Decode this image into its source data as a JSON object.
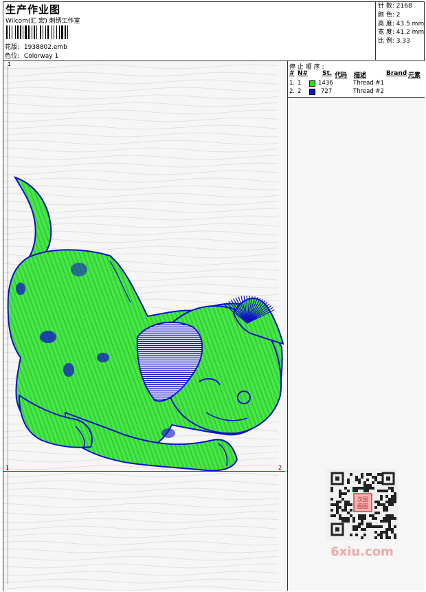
{
  "header": {
    "title": "生产作业图",
    "company": "Wilcom(汇 宏) 刺绣工作室",
    "file_label": "花版:",
    "file_value": "1938802.emb",
    "colorway_label": "色位:",
    "colorway_value": "Colorway 1"
  },
  "stats": [
    {
      "label": "针 数:",
      "value": "2168"
    },
    {
      "label": "颜 色:",
      "value": "2"
    },
    {
      "label": "高 度:",
      "value": "43.5 mm"
    },
    {
      "label": "宽 度:",
      "value": "41.2 mm"
    },
    {
      "label": "比 例:",
      "value": "3.33"
    }
  ],
  "thread_table": {
    "stop_label": "停 止 顺 序 :",
    "columns": {
      "num": "#",
      "n": "N#",
      "st": "St.",
      "code": "代码",
      "desc": "描述",
      "brand": "Brand",
      "elem": "元素"
    },
    "rows": [
      {
        "num": "1.",
        "n": "1",
        "color": "#22dd22",
        "stitches": "1436",
        "desc": "Thread #1"
      },
      {
        "num": "2.",
        "n": "2",
        "color": "#1010c8",
        "stitches": "727",
        "desc": "Thread #2"
      }
    ]
  },
  "rulers": {
    "top_left": "1",
    "bottom_left": "1",
    "bottom_right": "2"
  },
  "colors": {
    "thread1": "#22dd22",
    "thread2": "#1010c8",
    "ruler": "#d01010"
  },
  "watermark": {
    "text": "6xiu.com",
    "seal": "汉图 图图"
  }
}
